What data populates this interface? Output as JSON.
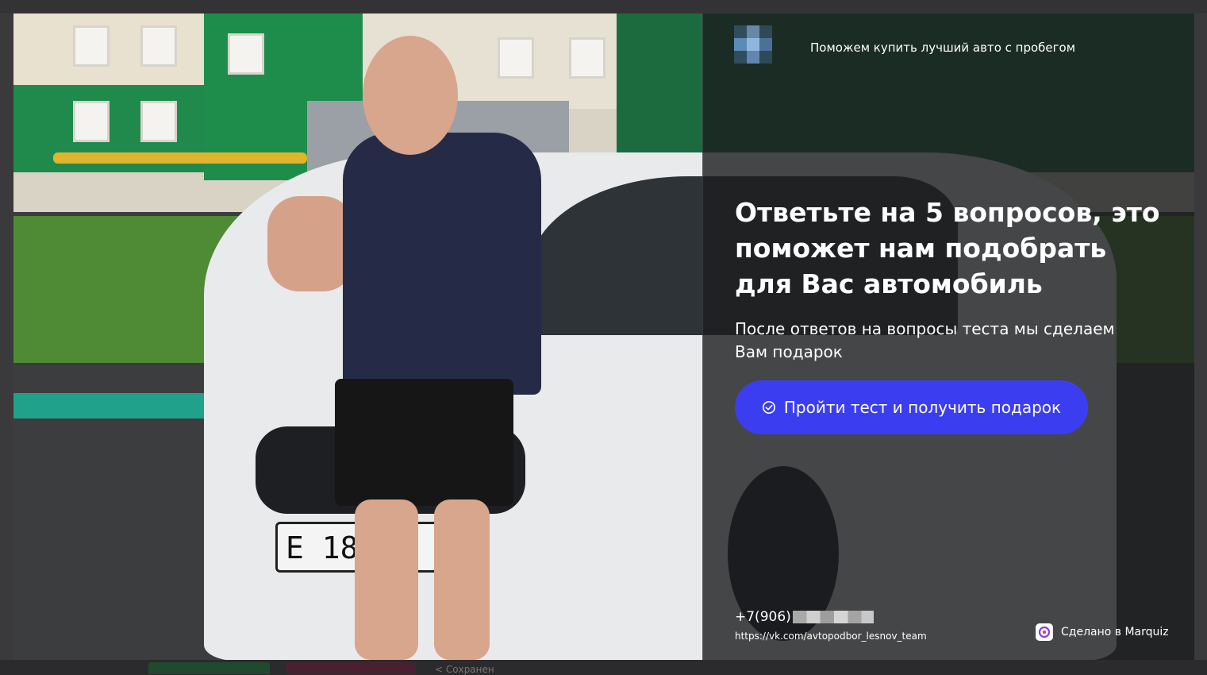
{
  "backdrop": {
    "bottom_text": "< Сохранен"
  },
  "modal": {
    "tagline": "Поможем купить лучший авто с пробегом",
    "headline": "Ответьте на 5 вопросов, это поможет нам подобрать для Вас автомобиль",
    "subline": "После ответов на вопросы теста мы сделаем Вам подарок",
    "cta_label": "Пройти тест и получить подарок",
    "cta_icon": "check-circle-icon",
    "phone_prefix": "+7(906)",
    "link": "https://vk.com/avtopodbor_lesnov_team",
    "made_with": "Сделано в Marquiz",
    "photo": {
      "plate_text": "E 180"
    }
  },
  "colors": {
    "accent": "#3b3ef0",
    "overlay": "#1c1d1f"
  }
}
